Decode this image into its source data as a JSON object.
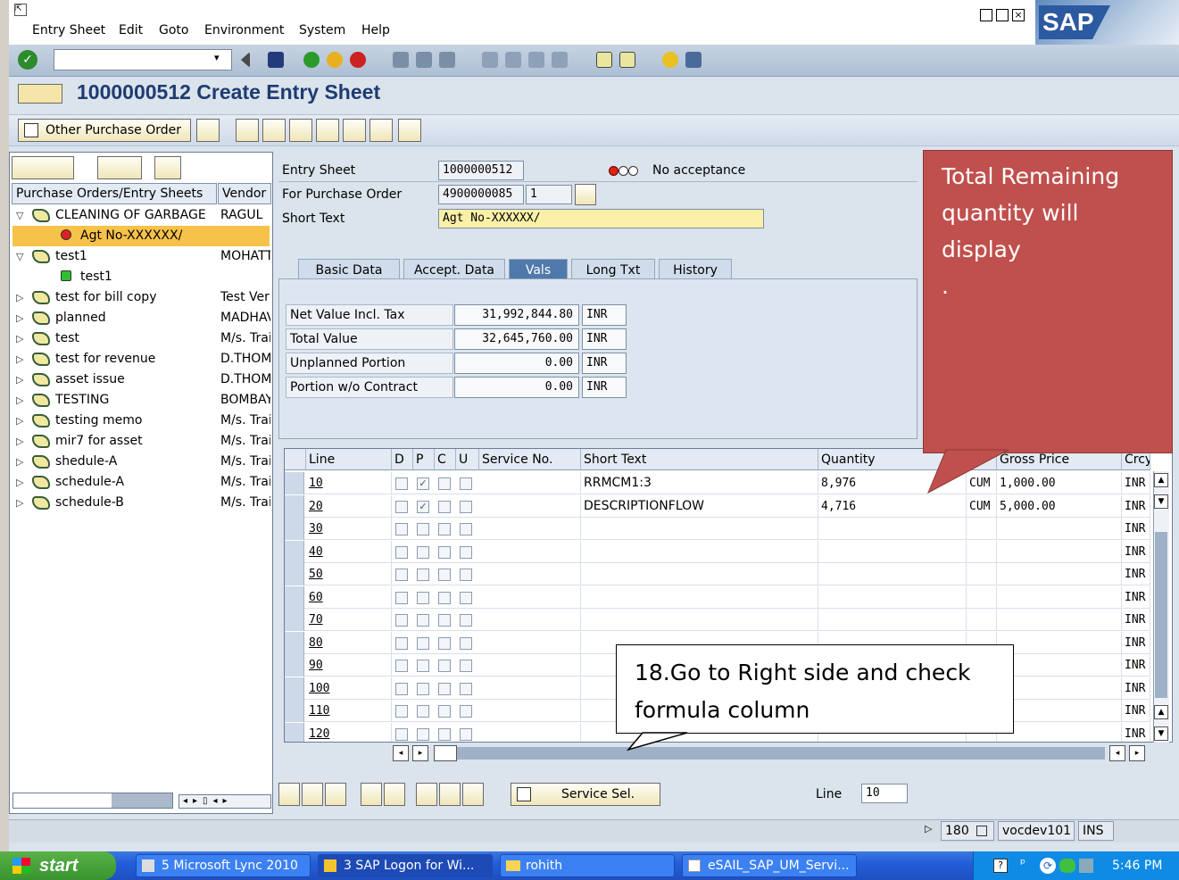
{
  "menu": [
    "Entry Sheet",
    "Edit",
    "Goto",
    "Environment",
    "System",
    "Help"
  ],
  "logo": "SAP",
  "page_title": "1000000512 Create Entry Sheet",
  "app_toolbar": {
    "other_po_label": "Other Purchase Order"
  },
  "tree": {
    "col_po": "Purchase Orders/Entry Sheets",
    "col_vendor": "Vendor",
    "rows": [
      {
        "name": "CLEANING OF GARBAGE",
        "vendor": "RAGUL"
      },
      {
        "name": "Agt No-XXXXXX/",
        "vendor": ""
      },
      {
        "name": "test1",
        "vendor": "MOHATT"
      },
      {
        "name": "test1",
        "vendor": ""
      },
      {
        "name": "test for bill copy",
        "vendor": "Test Ver"
      },
      {
        "name": "planned",
        "vendor": "MADHAV"
      },
      {
        "name": "test",
        "vendor": "M/s. Trai"
      },
      {
        "name": "test for revenue",
        "vendor": "D.THOM"
      },
      {
        "name": "asset issue",
        "vendor": "D.THOM"
      },
      {
        "name": "TESTING",
        "vendor": "BOMBAY"
      },
      {
        "name": "testing memo",
        "vendor": "M/s. Trai"
      },
      {
        "name": "mir7 for asset",
        "vendor": "M/s. Trai"
      },
      {
        "name": "shedule-A",
        "vendor": "M/s. Trai"
      },
      {
        "name": "schedule-A",
        "vendor": "M/s. Trai"
      },
      {
        "name": "schedule-B",
        "vendor": "M/s. Trai"
      }
    ]
  },
  "header": {
    "entry_sheet_label": "Entry Sheet",
    "entry_sheet_value": "1000000512",
    "status_text": "No acceptance",
    "po_label": "For Purchase Order",
    "po_value": "4900000085",
    "po_item": "1",
    "short_text_label": "Short Text",
    "short_text_value": "Agt No-XXXXXX/"
  },
  "tabs": [
    "Basic Data",
    "Accept. Data",
    "Vals",
    "Long Txt",
    "History"
  ],
  "values": [
    {
      "label": "Net Value Incl. Tax",
      "value": "31,992,844.80",
      "currency": "INR"
    },
    {
      "label": "Total Value",
      "value": "32,645,760.00",
      "currency": "INR"
    },
    {
      "label": "Unplanned Portion",
      "value": "0.00",
      "currency": "INR"
    },
    {
      "label": "Portion w/o Contract",
      "value": "0.00",
      "currency": "INR"
    }
  ],
  "table": {
    "headers": [
      "Line",
      "D",
      "P",
      "C",
      "U",
      "Service No.",
      "Short Text",
      "Quantity",
      "",
      "Gross Price",
      "Crcy"
    ],
    "rows": [
      {
        "line": "10",
        "text": "RRMCM1:3",
        "qty": "8,976",
        "unit": "CUM",
        "price": "1,000.00",
        "crcy": "INR",
        "p": true
      },
      {
        "line": "20",
        "text": "DESCRIPTIONFLOW",
        "qty": "4,716",
        "unit": "CUM",
        "price": "5,000.00",
        "crcy": "INR",
        "p": true
      },
      {
        "line": "30",
        "text": "",
        "qty": "",
        "unit": "",
        "price": "",
        "crcy": "INR",
        "p": false
      },
      {
        "line": "40",
        "text": "",
        "qty": "",
        "unit": "",
        "price": "",
        "crcy": "INR",
        "p": false
      },
      {
        "line": "50",
        "text": "",
        "qty": "",
        "unit": "",
        "price": "",
        "crcy": "INR",
        "p": false
      },
      {
        "line": "60",
        "text": "",
        "qty": "",
        "unit": "",
        "price": "",
        "crcy": "INR",
        "p": false
      },
      {
        "line": "70",
        "text": "",
        "qty": "",
        "unit": "",
        "price": "",
        "crcy": "INR",
        "p": false
      },
      {
        "line": "80",
        "text": "",
        "qty": "",
        "unit": "",
        "price": "",
        "crcy": "INR",
        "p": false
      },
      {
        "line": "90",
        "text": "",
        "qty": "",
        "unit": "",
        "price": "",
        "crcy": "INR",
        "p": false
      },
      {
        "line": "100",
        "text": "",
        "qty": "",
        "unit": "",
        "price": "",
        "crcy": "INR",
        "p": false
      },
      {
        "line": "110",
        "text": "",
        "qty": "",
        "unit": "",
        "price": "",
        "crcy": "INR",
        "p": false
      },
      {
        "line": "120",
        "text": "",
        "qty": "",
        "unit": "",
        "price": "",
        "crcy": "INR",
        "p": false
      }
    ]
  },
  "bottom": {
    "service_sel_label": "Service Sel.",
    "line_label": "Line",
    "line_value": "10"
  },
  "callouts": {
    "red_line1": "Total Remaining",
    "red_line2": "quantity will display",
    "red_line3": ".",
    "white_line1": "18.Go to Right side and check",
    "white_line2": "formula column"
  },
  "status": {
    "transaction": "180",
    "server": "vocdev101",
    "mode": "INS"
  },
  "taskbar": {
    "start": "start",
    "tasks": [
      "5 Microsoft Lync 2010",
      "3 SAP Logon for Wi...",
      "rohith",
      "eSAIL_SAP_UM_Servi..."
    ],
    "clock": "5:46 PM"
  },
  "colors": {
    "callout_red": "#c0504d",
    "title_blue": "#1d3c71",
    "tab_active": "#4f79ab"
  }
}
